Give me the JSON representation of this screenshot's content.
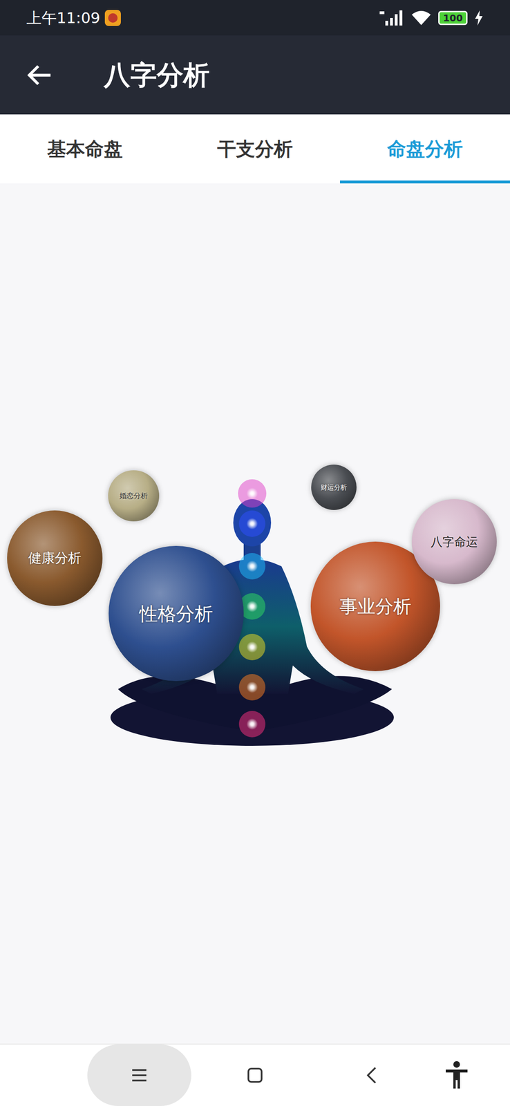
{
  "status_bar": {
    "time": "上午11:09",
    "battery": "100"
  },
  "app_bar": {
    "title": "八字分析"
  },
  "tabs": [
    {
      "label": "基本命盘",
      "selected": false
    },
    {
      "label": "干支分析",
      "selected": false
    },
    {
      "label": "命盘分析",
      "selected": true
    }
  ],
  "planets": [
    {
      "label": "婚恋分析",
      "color": "#b7ae86"
    },
    {
      "label": "财运分析",
      "color": "#4a4d52"
    },
    {
      "label": "健康分析",
      "color": "#8a5a2e"
    },
    {
      "label": "性格分析",
      "color": "#2e4f8f"
    },
    {
      "label": "事业分析",
      "color": "#c2552a"
    },
    {
      "label": "八字命运",
      "color": "#d7b9cc"
    }
  ]
}
